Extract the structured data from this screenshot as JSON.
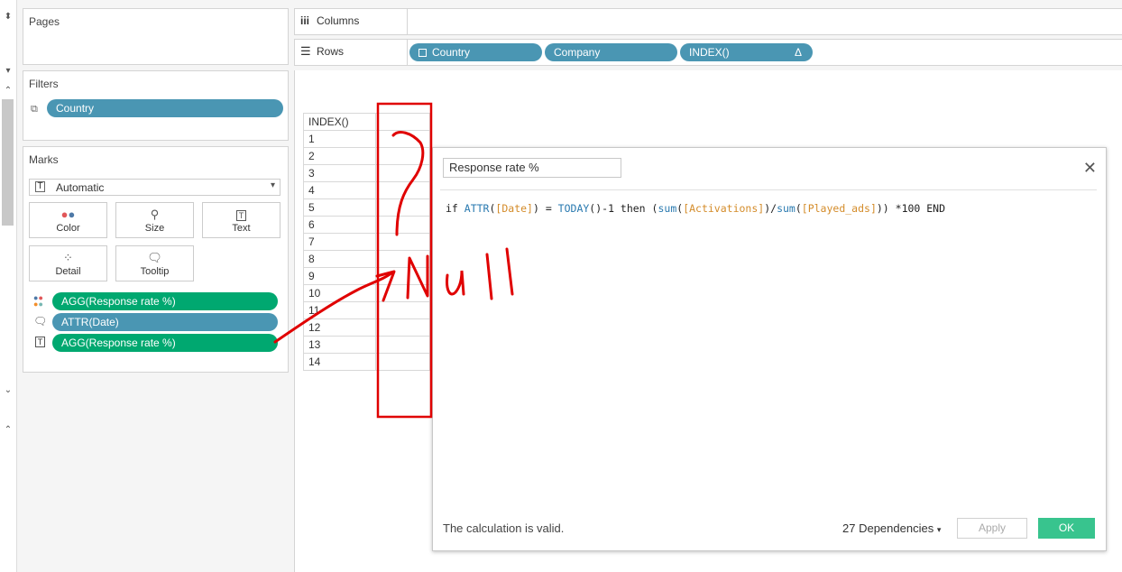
{
  "pages_card": {
    "title": "Pages"
  },
  "shelves": {
    "columns_label": "Columns",
    "rows_label": "Rows",
    "rows_pills": [
      "Country",
      "Company",
      "INDEX()"
    ],
    "rows_delta": "Δ"
  },
  "filters_card": {
    "title": "Filters",
    "pill": "Country"
  },
  "marks_card": {
    "title": "Marks",
    "mark_type": "Automatic",
    "buttons": {
      "color": "Color",
      "size": "Size",
      "text": "Text",
      "detail": "Detail",
      "tooltip": "Tooltip"
    },
    "pills": [
      "AGG(Response rate %)",
      "ATTR(Date)",
      "AGG(Response rate %)"
    ]
  },
  "view": {
    "header": "INDEX()",
    "rows": [
      "1",
      "2",
      "3",
      "4",
      "5",
      "6",
      "7",
      "8",
      "9",
      "10",
      "11",
      "12",
      "13",
      "14"
    ]
  },
  "dialog": {
    "name": "Response rate %",
    "close": "✕",
    "formula": {
      "t1": "if ",
      "t2": "ATTR",
      "t3": "(",
      "t4": "[Date]",
      "t5": ") = ",
      "t6": "TODAY",
      "t7": "()-1 then (",
      "t8": "sum",
      "t9": "(",
      "t10": "[Activations]",
      "t11": ")/",
      "t12": "sum",
      "t13": "(",
      "t14": "[Played_ads]",
      "t15": ")) *100 END"
    },
    "status": "The calculation is valid.",
    "dependencies": "27 Dependencies",
    "apply_label": "Apply",
    "ok_label": "OK"
  },
  "annotation": {
    "text": "Null",
    "question": "?"
  },
  "colors": {
    "pill_blue": "#4a96b3",
    "pill_green": "#00a870",
    "ok_green": "#38c48e",
    "annotation_red": "#e00000"
  }
}
